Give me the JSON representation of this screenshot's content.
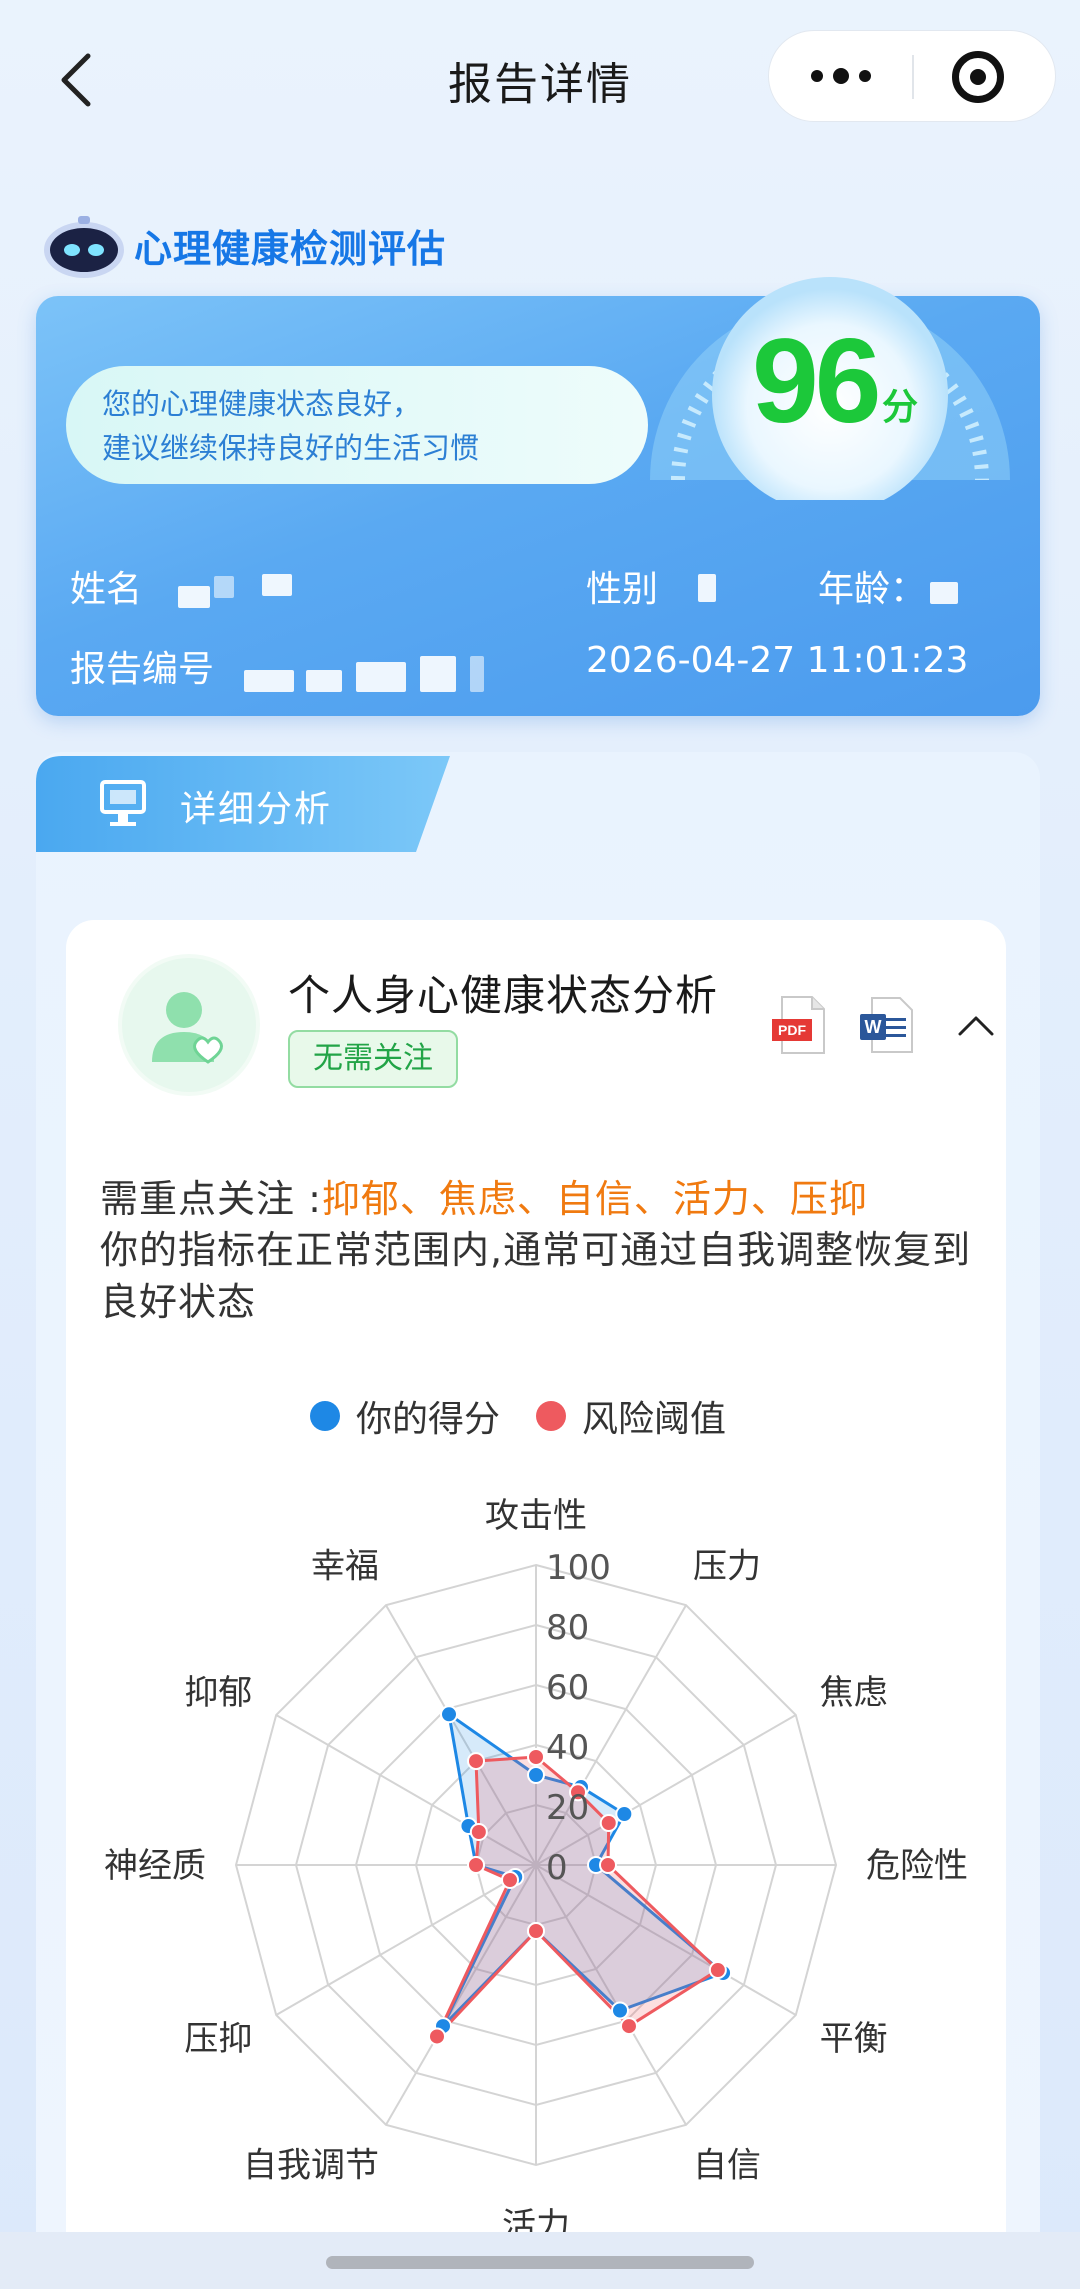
{
  "nav": {
    "title": "报告详情"
  },
  "report": {
    "assessment_title": "心理健康检测评估",
    "message_line1": "您的心理健康状态良好，",
    "message_line2": "建议继续保持良好的生活习惯",
    "score": "96",
    "score_unit": "分",
    "name_label": "姓名",
    "gender_label": "性别",
    "age_label": "年龄：",
    "report_no_label": "报告编号",
    "datetime": "2026-04-27 11:01:23",
    "score_color": "#1cc83a"
  },
  "detail": {
    "tab_label": "详细分析",
    "card_title": "个人身心健康状态分析",
    "status_tag": "无需关注",
    "focus_prefix": "需重点关注 :",
    "focus_items": "抑郁、焦虑、自信、活力、压抑",
    "description": "你的指标在正常范围内,通常可通过自我调整恢复到良好状态",
    "pdf_icon_text": "PDF",
    "word_icon_text": "W"
  },
  "chart_data": {
    "type": "radar",
    "axes": [
      "攻击性",
      "压力",
      "焦虑",
      "危险性",
      "平衡",
      "自信",
      "活力",
      "自我调节",
      "压抑",
      "神经质",
      "抑郁",
      "幸福"
    ],
    "ticks": [
      "0",
      "20",
      "40",
      "60",
      "80",
      "100"
    ],
    "range": [
      0,
      100
    ],
    "legend_placement": "top-center",
    "series": [
      {
        "name": "你的得分",
        "color": "#1e88e5",
        "values": [
          30,
          30,
          34,
          20,
          72,
          56,
          22,
          62,
          8,
          20,
          26,
          58
        ]
      },
      {
        "name": "风险阈值",
        "color": "#ee5a5f",
        "values": [
          36,
          28,
          28,
          24,
          70,
          62,
          22,
          66,
          10,
          20,
          22,
          40
        ]
      }
    ]
  }
}
